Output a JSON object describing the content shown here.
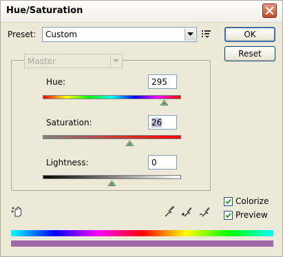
{
  "window": {
    "title": "Hue/Saturation"
  },
  "preset": {
    "label": "Preset:",
    "value": "Custom"
  },
  "buttons": {
    "ok": "OK",
    "reset": "Reset"
  },
  "channel": {
    "value": "Master"
  },
  "hue": {
    "label": "Hue:",
    "value": "295",
    "level": 295
  },
  "saturation": {
    "label": "Saturation:",
    "value": "26",
    "level": 26
  },
  "lightness": {
    "label": "Lightness:",
    "value": "0",
    "level": 0
  },
  "options": {
    "colorize": "Colorize",
    "preview": "Preview",
    "colorize_checked": true,
    "preview_checked": true
  },
  "colors": {
    "result_bar": "#a068a8",
    "thumb": "#3a7a3a",
    "accent": "#3a6ea5"
  }
}
